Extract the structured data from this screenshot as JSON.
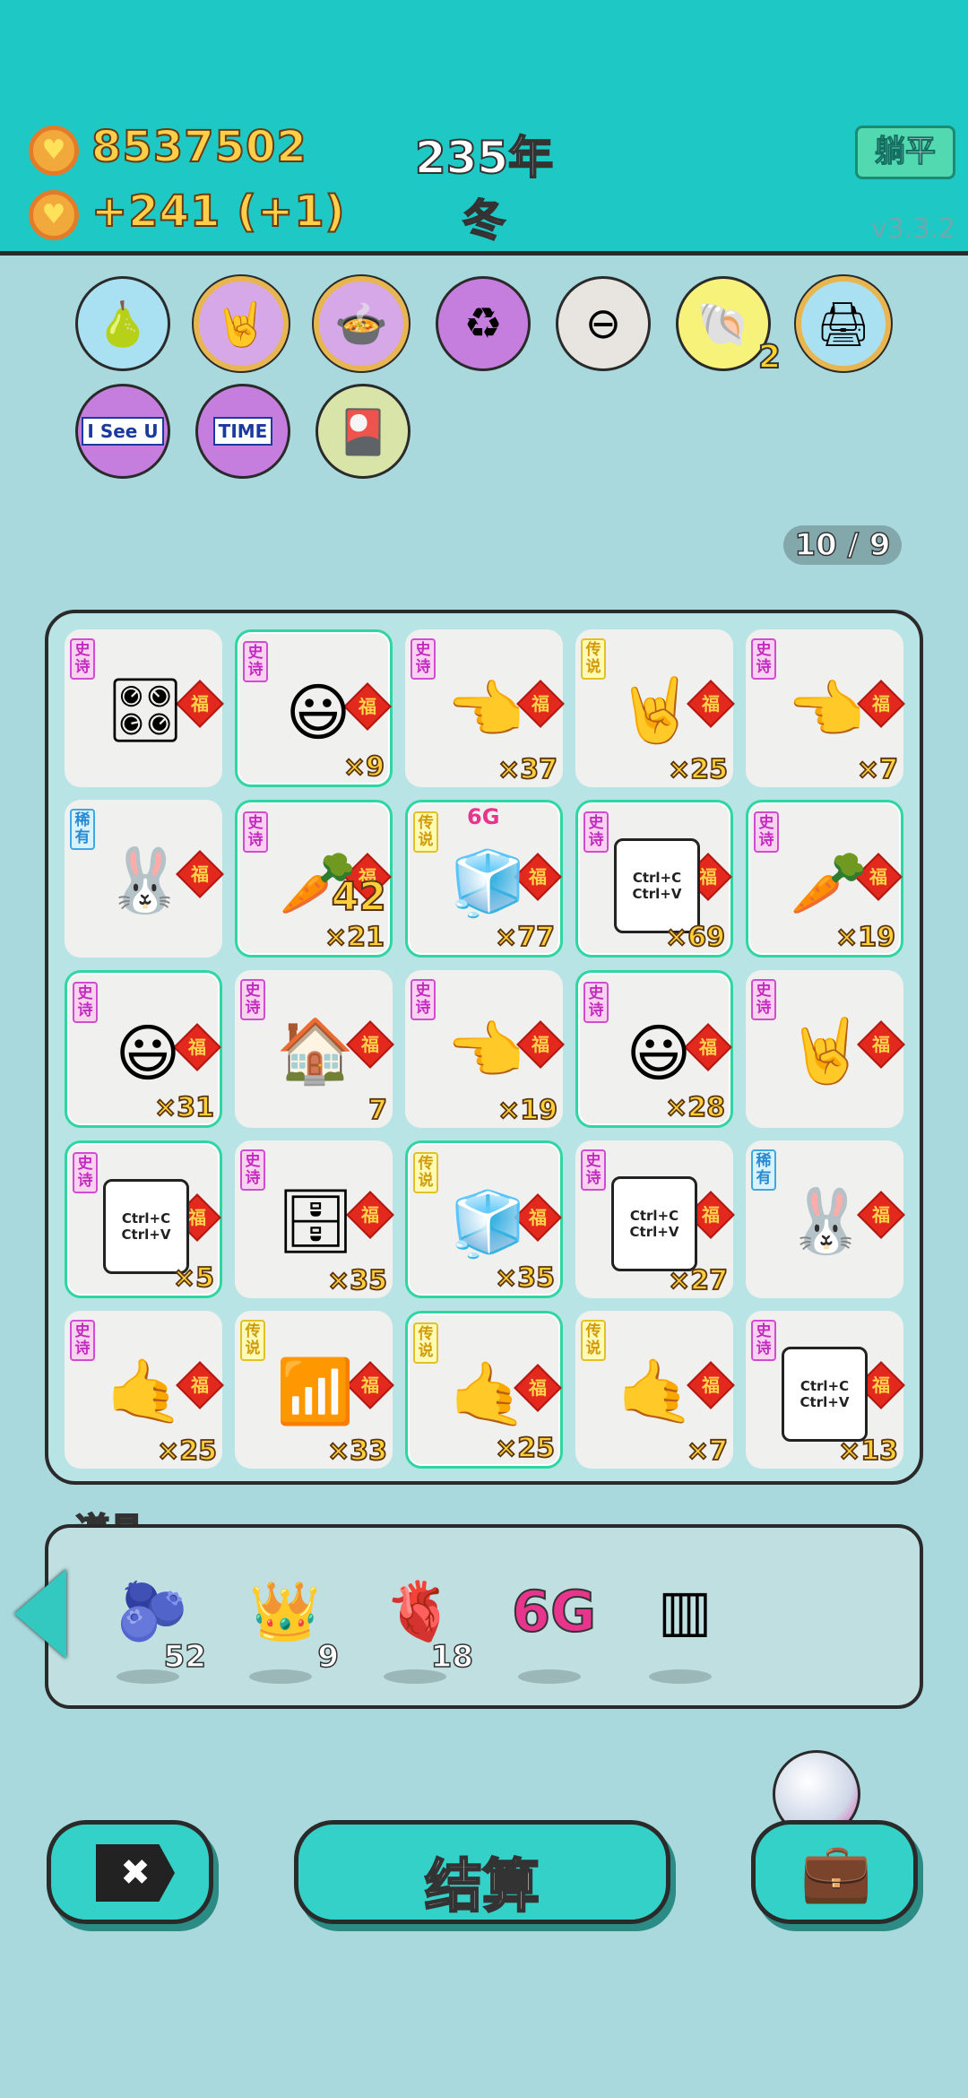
{
  "header": {
    "gold": "8537502",
    "income": "+241 (+1)",
    "year": "235年",
    "season": "冬",
    "lie_flat_label": "躺平",
    "version": "v3.3.2"
  },
  "relics": [
    {
      "icon": "pomelo-icon",
      "glyph": "🍐",
      "bg": "#a9e1f2"
    },
    {
      "icon": "rock-hand-icon",
      "glyph": "🤘",
      "bg": "#d6a8e8",
      "gold": true
    },
    {
      "icon": "rice-cooker-icon",
      "glyph": "🍲",
      "bg": "#d6a8e8",
      "gold": true
    },
    {
      "icon": "recycle-icon",
      "glyph": "♻",
      "bg": "#c67ede"
    },
    {
      "icon": "minus-icon",
      "glyph": "⊖",
      "bg": "#e8e4e0"
    },
    {
      "icon": "shell-icon",
      "glyph": "🐚",
      "bg": "#f7f27a",
      "count": "2"
    },
    {
      "icon": "printer-icon",
      "glyph": "🖨",
      "bg": "#a9e1f2",
      "gold": true
    },
    {
      "icon": "i-see-u-icon",
      "glyph": "I See U",
      "bg": "#c67ede"
    },
    {
      "icon": "time-magazine-icon",
      "glyph": "TIME",
      "bg": "#c67ede"
    },
    {
      "icon": "card-pack-icon",
      "glyph": "🎴",
      "bg": "#d9e5a8"
    }
  ],
  "pager": "10 / 9",
  "rarity_labels": {
    "epic": "史诗",
    "leg": "传说",
    "rare": "稀有"
  },
  "fu": "福",
  "tiles": [
    {
      "name": "graphics-card",
      "rarity": "epic",
      "art": "🎛",
      "count": "",
      "hl": false
    },
    {
      "name": "face",
      "rarity": "epic",
      "art": "😃",
      "count": "×9",
      "hl": true
    },
    {
      "name": "pointing-hand-grey",
      "rarity": "epic",
      "art": "👈",
      "count": "×37",
      "hl": false
    },
    {
      "name": "rock-hand-yellow",
      "rarity": "leg",
      "art": "🤘",
      "count": "×25",
      "hl": false
    },
    {
      "name": "pointing-hand-grey",
      "rarity": "epic",
      "art": "👈",
      "count": "×7",
      "hl": false
    },
    {
      "name": "rabbit-bubble",
      "rarity": "rare",
      "art": "🐰",
      "count": "",
      "hl": false
    },
    {
      "name": "carrot-coin",
      "rarity": "epic",
      "art": "🥕",
      "count": "×21",
      "hl": true,
      "extra": "42"
    },
    {
      "name": "fridge-6g",
      "rarity": "leg",
      "art": "🧊",
      "count": "×77",
      "hl": true,
      "top": "6G"
    },
    {
      "name": "ctrl-c-v",
      "rarity": "epic",
      "art": "Ctrl+C Ctrl+V",
      "count": "×69",
      "hl": true,
      "txt": true
    },
    {
      "name": "carrot",
      "rarity": "epic",
      "art": "🥕",
      "count": "×19",
      "hl": true
    },
    {
      "name": "face",
      "rarity": "epic",
      "art": "😃",
      "count": "×31",
      "hl": true
    },
    {
      "name": "rabbit-house",
      "rarity": "epic",
      "art": "🏠",
      "count": "7",
      "hl": false
    },
    {
      "name": "pointing-hand-grey",
      "rarity": "epic",
      "art": "👈",
      "count": "×19",
      "hl": false
    },
    {
      "name": "face",
      "rarity": "epic",
      "art": "😃",
      "count": "×28",
      "hl": true
    },
    {
      "name": "rock-hand-grey",
      "rarity": "epic",
      "art": "🤘",
      "count": "",
      "hl": false
    },
    {
      "name": "ctrl-c-v",
      "rarity": "epic",
      "art": "Ctrl+C Ctrl+V",
      "count": "×5",
      "hl": true,
      "txt": true
    },
    {
      "name": "server",
      "rarity": "epic",
      "art": "🗄",
      "count": "×35",
      "hl": false
    },
    {
      "name": "fridge",
      "rarity": "leg",
      "art": "🧊",
      "count": "×35",
      "hl": true
    },
    {
      "name": "ctrl-c-v",
      "rarity": "epic",
      "art": "Ctrl+C Ctrl+V",
      "count": "×27",
      "hl": false,
      "txt": true
    },
    {
      "name": "rabbit",
      "rarity": "rare",
      "art": "🐰",
      "count": "",
      "hl": false
    },
    {
      "name": "hand-grey",
      "rarity": "epic",
      "art": "🤙",
      "count": "×25",
      "hl": false
    },
    {
      "name": "wifi",
      "rarity": "leg",
      "art": "📶",
      "count": "×33",
      "hl": false
    },
    {
      "name": "hand-yellow",
      "rarity": "leg",
      "art": "🤙",
      "count": "×25",
      "hl": true
    },
    {
      "name": "hand-yellow",
      "rarity": "leg",
      "art": "🤙",
      "count": "×7",
      "hl": false
    },
    {
      "name": "ctrl-c-v",
      "rarity": "epic",
      "art": "Ctrl+C Ctrl+V",
      "count": "×13",
      "hl": false,
      "txt": true
    }
  ],
  "props": {
    "title": "道具",
    "items": [
      {
        "icon": "blueberry-icon",
        "glyph": "🫐",
        "count": "52"
      },
      {
        "icon": "crown-icon",
        "glyph": "👑",
        "count": "9"
      },
      {
        "icon": "liver-icon",
        "glyph": "🫀",
        "count": "18"
      },
      {
        "icon": "six-g-icon",
        "glyph": "6G",
        "count": ""
      },
      {
        "icon": "rare-cards-icon",
        "glyph": "▥",
        "count": ""
      }
    ]
  },
  "buttons": {
    "close": "✖",
    "settle": "结算",
    "bag": "💼"
  }
}
